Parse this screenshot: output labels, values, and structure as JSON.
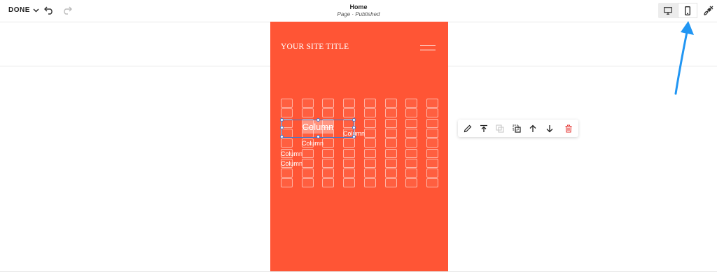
{
  "toolbar_top": {
    "done_label": "DONE",
    "page_title": "Home",
    "page_status": "Page · Published"
  },
  "view_switcher": {
    "desktop_icon": "desktop-icon",
    "mobile_icon": "mobile-icon",
    "active": "mobile"
  },
  "site": {
    "title": "YOUR SITE TITLE",
    "background_color": "#ff5535"
  },
  "columns": {
    "count": 8,
    "rows": 9,
    "labels": [
      "Column",
      "Column",
      "Column",
      "Column",
      "Column"
    ]
  },
  "block_toolbar": {
    "actions": [
      "edit-icon",
      "move-to-top-icon",
      "duplicate-disabled-icon",
      "duplicate-icon",
      "move-up-icon",
      "move-down-icon",
      "delete-icon"
    ]
  },
  "colors": {
    "accent_blue": "#3a7bd5",
    "arrow_blue": "#2196f3",
    "delete_red": "#e53935"
  }
}
